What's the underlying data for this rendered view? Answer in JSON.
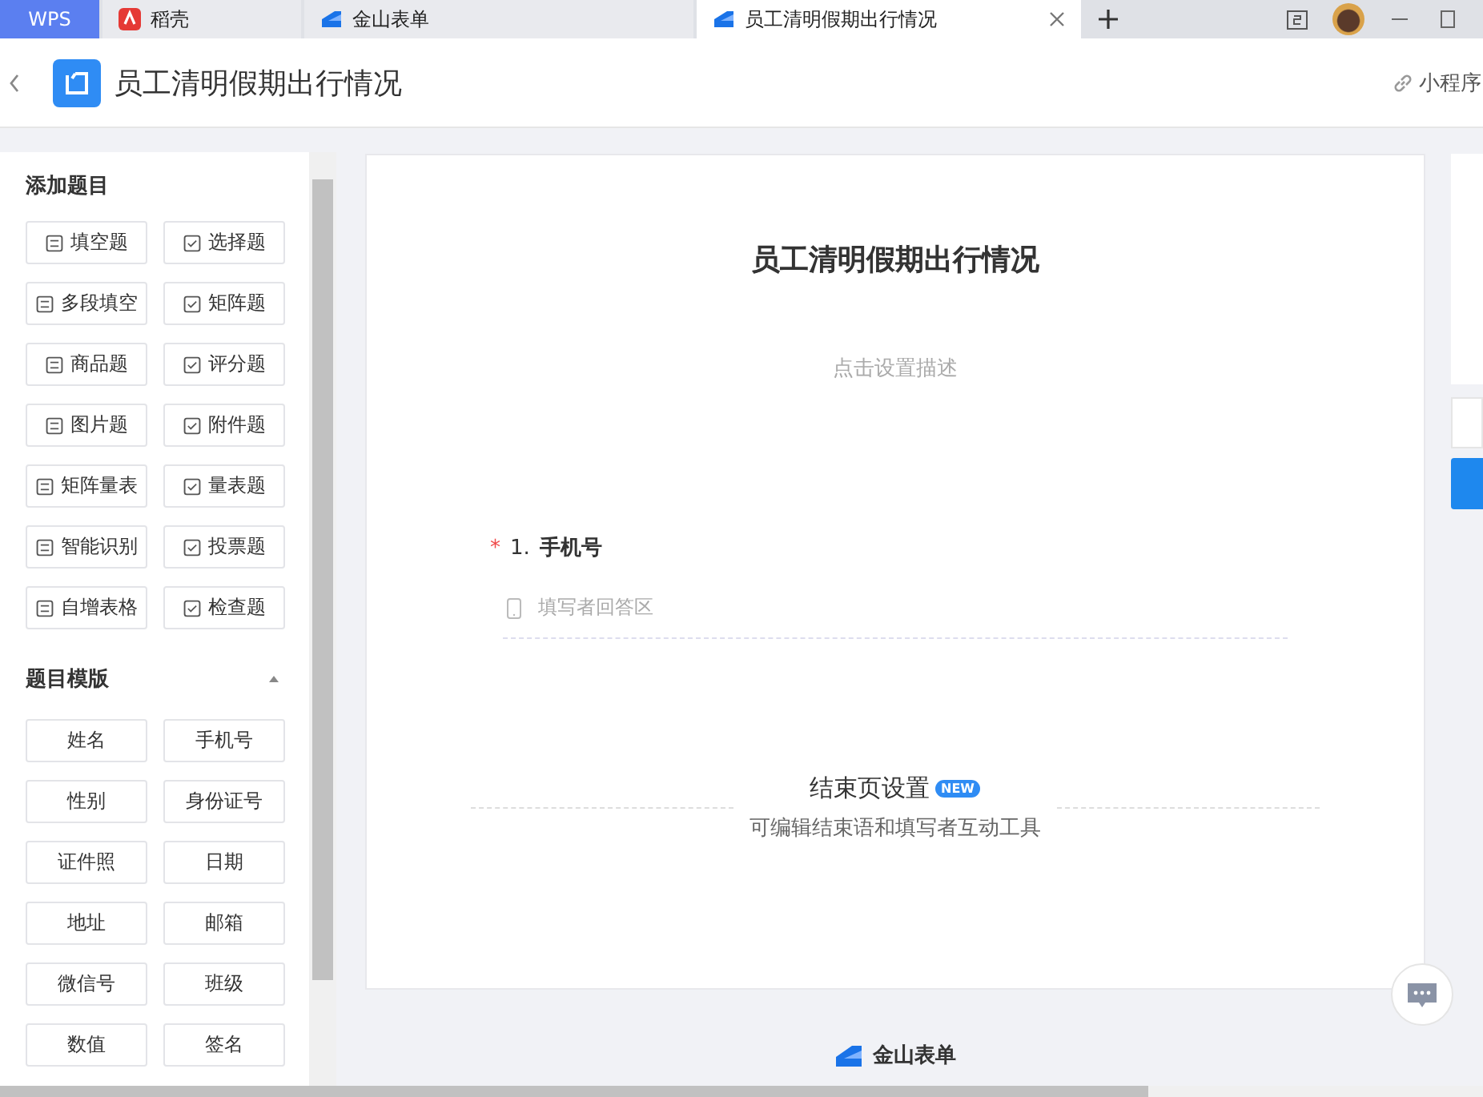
{
  "tabs": [
    {
      "label": "WPS",
      "selected": false,
      "kind": "brand"
    },
    {
      "label": "稻壳",
      "selected": false,
      "kind": "red"
    },
    {
      "label": "金山表单",
      "selected": false,
      "kind": "blue"
    },
    {
      "label": "员工清明假期出行情况",
      "selected": true,
      "kind": "blue"
    }
  ],
  "header": {
    "title": "员工清明假期出行情况",
    "mini_program": "小程序"
  },
  "sidebar": {
    "add_title": "添加题目",
    "question_types": [
      "填空题",
      "选择题",
      "多段填空",
      "矩阵题",
      "商品题",
      "评分题",
      "图片题",
      "附件题",
      "矩阵量表",
      "量表题",
      "智能识别",
      "投票题",
      "自增表格",
      "检查题"
    ],
    "template_title": "题目模版",
    "templates_expanded": true,
    "templates": [
      "姓名",
      "手机号",
      "性别",
      "身份证号",
      "证件照",
      "日期",
      "地址",
      "邮箱",
      "微信号",
      "班级",
      "数值",
      "签名"
    ]
  },
  "form": {
    "title": "员工清明假期出行情况",
    "description_placeholder": "点击设置描述",
    "questions": [
      {
        "number": "1.",
        "required": true,
        "required_mark": "*",
        "title": "手机号",
        "placeholder": "填写者回答区"
      }
    ],
    "end_page": {
      "title": "结束页设置",
      "badge": "NEW",
      "subtitle": "可编辑结束语和填写者互动工具"
    }
  },
  "footer": {
    "brand": "金山表单"
  }
}
